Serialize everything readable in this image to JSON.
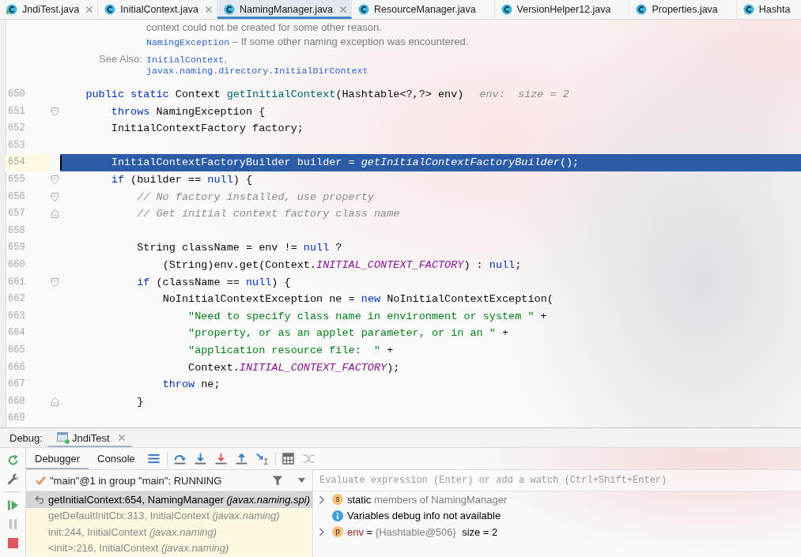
{
  "tabs": [
    {
      "label": "JndiTest.java",
      "kind": "runnable",
      "closable": true,
      "selected": false
    },
    {
      "label": "InitialContext.java",
      "kind": "class",
      "closable": true,
      "selected": false
    },
    {
      "label": "NamingManager.java",
      "kind": "class",
      "closable": true,
      "selected": true
    },
    {
      "label": "ResourceManager.java",
      "kind": "class",
      "closable": false,
      "selected": false
    },
    {
      "label": "VersionHelper12.java",
      "kind": "class",
      "closable": false,
      "selected": false
    },
    {
      "label": "Properties.java",
      "kind": "class",
      "closable": false,
      "selected": false
    },
    {
      "label": "Hashta",
      "kind": "class",
      "closable": false,
      "selected": false
    }
  ],
  "doc": {
    "throws": [
      [
        {
          "text": "context could not be created for some other reason.",
          "kind": "text"
        }
      ],
      [
        {
          "text": "NamingException",
          "kind": "link"
        },
        {
          "text": " – If some other naming exception was encountered.",
          "kind": "text"
        }
      ]
    ],
    "see_also": {
      "label": "See Also:",
      "items": [
        [
          {
            "text": "InitialContext",
            "kind": "link"
          },
          {
            "text": ",",
            "kind": "text"
          }
        ],
        [
          {
            "text": "javax.naming.directory.InitialDirContext",
            "kind": "link"
          }
        ]
      ]
    }
  },
  "code": {
    "lines": [
      {
        "number": "650",
        "current": false,
        "tokens": [
          {
            "text": "    public static",
            "kind": "keyword"
          },
          {
            "text": " Context ",
            "kind": "plain"
          },
          {
            "text": "getInitialContext",
            "kind": "method"
          },
          {
            "text": "(Hashtable<?,?> env)",
            "kind": "plain"
          }
        ],
        "hint": "env:  size = 2"
      },
      {
        "number": "651",
        "current": false,
        "fold": {
          "kind": "start"
        },
        "tokens": [
          {
            "text": "        throws",
            "kind": "keyword"
          },
          {
            "text": " NamingException {",
            "kind": "plain"
          }
        ]
      },
      {
        "number": "652",
        "current": false,
        "tokens": [
          {
            "text": "        InitialContextFactory factory;",
            "kind": "plain"
          }
        ]
      },
      {
        "number": "653",
        "current": false
      },
      {
        "number": "654",
        "current": true,
        "tokens": [
          {
            "text": "        InitialContextFactoryBuilder builder = ",
            "kind": "plain"
          },
          {
            "text": "getInitialContextFactoryBuilder",
            "kind": "call"
          },
          {
            "text": "();",
            "kind": "plain"
          }
        ]
      },
      {
        "number": "655",
        "current": false,
        "fold": {
          "kind": "start"
        },
        "tokens": [
          {
            "text": "        if",
            "kind": "keyword"
          },
          {
            "text": " (builder == ",
            "kind": "plain"
          },
          {
            "text": "null",
            "kind": "keyword"
          },
          {
            "text": ") {",
            "kind": "plain"
          }
        ]
      },
      {
        "number": "656",
        "current": false,
        "fold": {
          "kind": "start"
        },
        "tokens": [
          {
            "text": "            // No factory installed, use property",
            "kind": "comment"
          }
        ]
      },
      {
        "number": "657",
        "current": false,
        "fold": {
          "kind": "end"
        },
        "tokens": [
          {
            "text": "            // Get initial context factory class name",
            "kind": "comment"
          }
        ]
      },
      {
        "number": "658",
        "current": false
      },
      {
        "number": "659",
        "current": false,
        "tokens": [
          {
            "text": "            String className = env != ",
            "kind": "plain"
          },
          {
            "text": "null",
            "kind": "keyword"
          },
          {
            "text": " ?",
            "kind": "plain"
          }
        ]
      },
      {
        "number": "660",
        "current": false,
        "tokens": [
          {
            "text": "                (String)env.get(Context.",
            "kind": "plain"
          },
          {
            "text": "INITIAL_CONTEXT_FACTORY",
            "kind": "constant"
          },
          {
            "text": ") : ",
            "kind": "plain"
          },
          {
            "text": "null",
            "kind": "keyword"
          },
          {
            "text": ";",
            "kind": "plain"
          }
        ]
      },
      {
        "number": "661",
        "current": false,
        "fold": {
          "kind": "start"
        },
        "tokens": [
          {
            "text": "            if",
            "kind": "keyword"
          },
          {
            "text": " (className == ",
            "kind": "plain"
          },
          {
            "text": "null",
            "kind": "keyword"
          },
          {
            "text": ") {",
            "kind": "plain"
          }
        ]
      },
      {
        "number": "662",
        "current": false,
        "tokens": [
          {
            "text": "                NoInitialContextException ne = ",
            "kind": "plain"
          },
          {
            "text": "new",
            "kind": "keyword"
          },
          {
            "text": " NoInitialContextException(",
            "kind": "plain"
          }
        ]
      },
      {
        "number": "663",
        "current": false,
        "tokens": [
          {
            "text": "                    \"Need to specify class name in environment or system \"",
            "kind": "string"
          },
          {
            "text": " +",
            "kind": "plain"
          }
        ]
      },
      {
        "number": "664",
        "current": false,
        "tokens": [
          {
            "text": "                    \"property, or as an applet parameter, or in an \"",
            "kind": "string"
          },
          {
            "text": " +",
            "kind": "plain"
          }
        ]
      },
      {
        "number": "665",
        "current": false,
        "tokens": [
          {
            "text": "                    \"application resource file:  \"",
            "kind": "string"
          },
          {
            "text": " +",
            "kind": "plain"
          }
        ]
      },
      {
        "number": "666",
        "current": false,
        "tokens": [
          {
            "text": "                    Context.",
            "kind": "plain"
          },
          {
            "text": "INITIAL_CONTEXT_FACTORY",
            "kind": "constant"
          },
          {
            "text": ");",
            "kind": "plain"
          }
        ]
      },
      {
        "number": "667",
        "current": false,
        "tokens": [
          {
            "text": "                throw",
            "kind": "keyword"
          },
          {
            "text": " ne;",
            "kind": "plain"
          }
        ]
      },
      {
        "number": "668",
        "current": false,
        "fold": {
          "kind": "end"
        },
        "tokens": [
          {
            "text": "            }",
            "kind": "plain"
          }
        ]
      },
      {
        "number": "669",
        "current": false
      }
    ]
  },
  "debug": {
    "label": "Debug:",
    "sessions": [
      {
        "label": "JndiTest",
        "selected": true,
        "closable": true
      }
    ],
    "side_toolbar": [
      {
        "kind": "rerun",
        "disabled": false
      },
      {
        "kind": "settings",
        "disabled": false
      },
      {
        "kind": "separator"
      },
      {
        "kind": "resume",
        "disabled": false
      },
      {
        "kind": "pause",
        "disabled": true
      },
      {
        "kind": "stop",
        "disabled": false
      }
    ],
    "view_tabs": [
      {
        "label": "Debugger",
        "selected": true
      },
      {
        "label": "Console",
        "selected": false
      }
    ],
    "toolbar": [
      {
        "kind": "layout",
        "disabled": false
      },
      {
        "kind": "separator"
      },
      {
        "kind": "step-over",
        "disabled": false
      },
      {
        "kind": "step-into",
        "disabled": false
      },
      {
        "kind": "force-step-into",
        "disabled": false
      },
      {
        "kind": "step-out",
        "disabled": false
      },
      {
        "kind": "run-to-cursor",
        "disabled": false
      },
      {
        "kind": "separator"
      },
      {
        "kind": "evaluate",
        "disabled": false
      },
      {
        "kind": "trace",
        "disabled": true
      }
    ],
    "thread": {
      "label": "\"main\"@1 in group \"main\": RUNNING"
    },
    "frames": [
      {
        "label": "getInitialContext:654, NamingManager *(javax.naming.spi)*",
        "selected": true,
        "library": false
      },
      {
        "label": "getDefaultInitCtx:313, InitialContext *(javax.naming)*",
        "selected": false,
        "library": true
      },
      {
        "label": "init:244, InitialContext *(javax.naming)*",
        "selected": false,
        "library": true
      },
      {
        "label": "<init>:216, InitialContext *(javax.naming)*",
        "selected": false,
        "library": true
      }
    ],
    "watch": {
      "placeholder": "Evaluate expression (Enter) or add a watch (Ctrl+Shift+Enter)"
    },
    "variables": [
      {
        "kind": "static",
        "badge": "s",
        "expanded": false,
        "parts": [
          {
            "text": "static",
            "kind": "plain"
          },
          {
            "text": " members of NamingManager",
            "kind": "muted"
          }
        ]
      },
      {
        "kind": "info",
        "expanded": false,
        "parts": [
          {
            "text": "Variables debug info not available",
            "kind": "plain"
          }
        ]
      },
      {
        "kind": "parameter",
        "badge": "p",
        "expanded": false,
        "parts": [
          {
            "text": "env",
            "kind": "name"
          },
          {
            "text": " = ",
            "kind": "plain"
          },
          {
            "text": "{Hashtable@506}",
            "kind": "muted"
          },
          {
            "text": "  size = 2",
            "kind": "plain"
          }
        ]
      }
    ]
  }
}
